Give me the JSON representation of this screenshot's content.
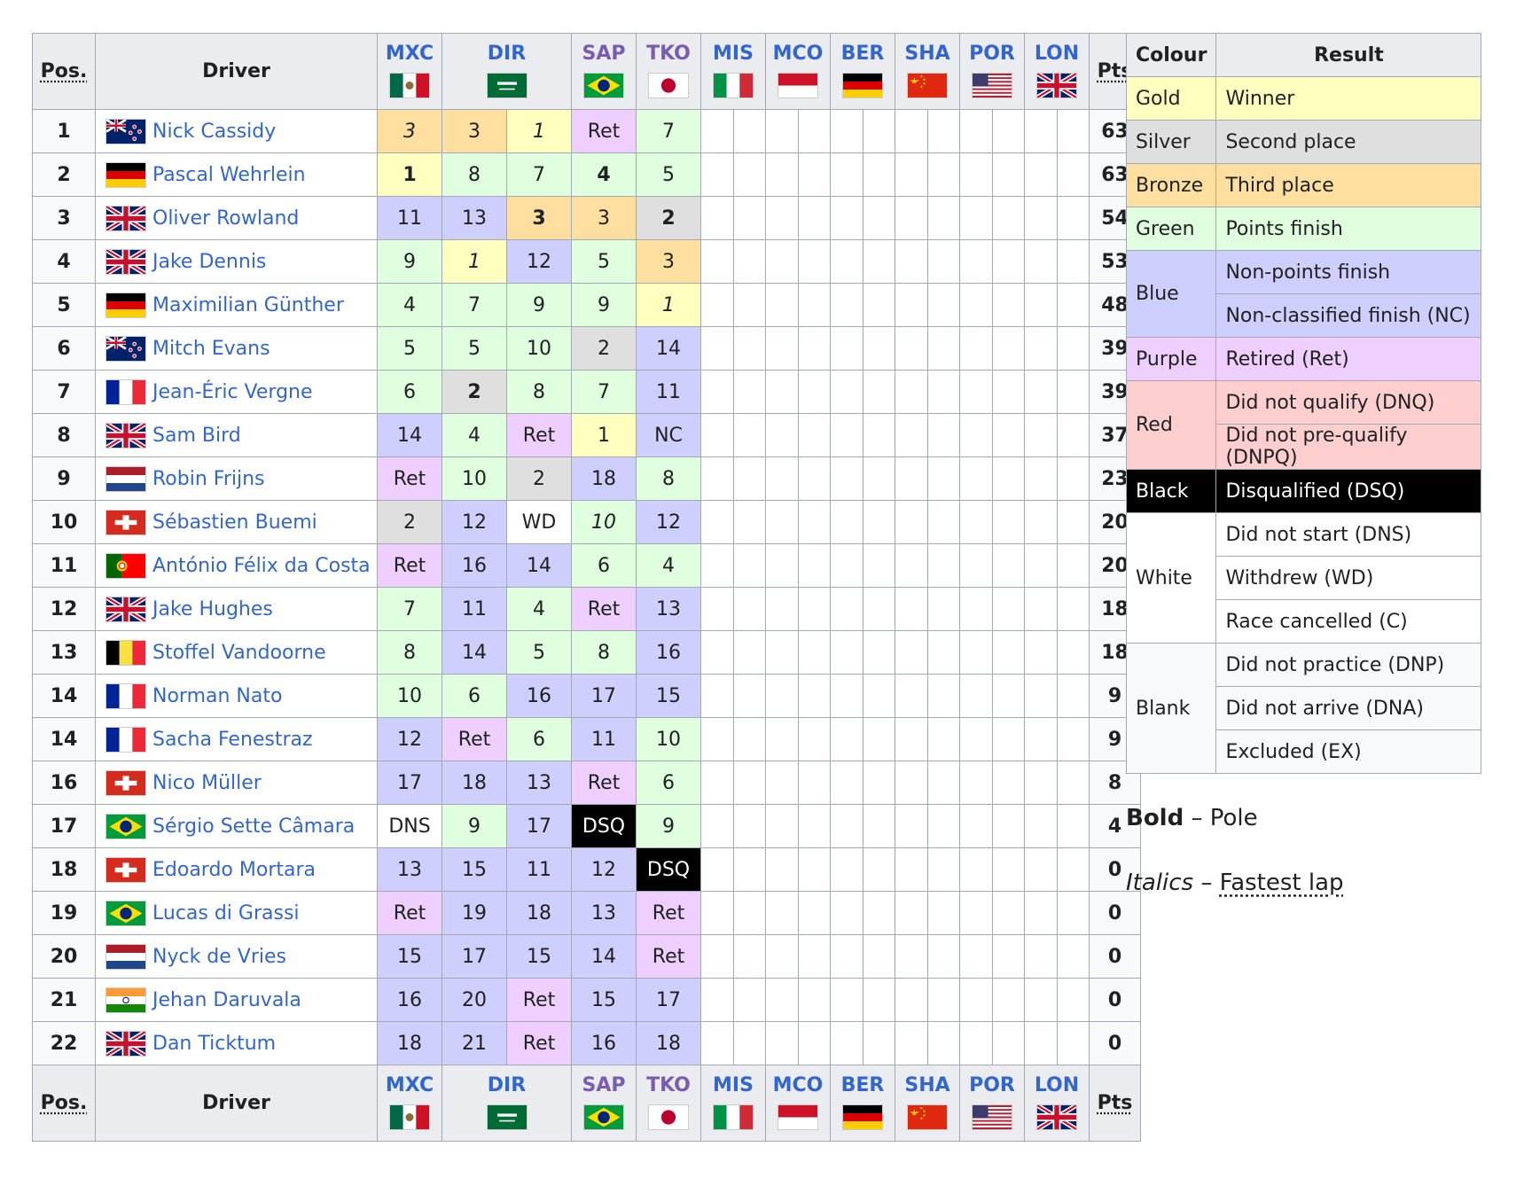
{
  "headers": {
    "pos": "Pos.",
    "driver": "Driver",
    "pts": "Pts"
  },
  "races": [
    {
      "code": "MXC",
      "flag": "mx",
      "visited": false
    },
    {
      "code": "DIR",
      "flag": "sa",
      "visited": false
    },
    {
      "code": "SAP",
      "flag": "br",
      "visited": true
    },
    {
      "code": "TKO",
      "flag": "jp",
      "visited": true
    },
    {
      "code": "MIS",
      "flag": "it",
      "visited": false
    },
    {
      "code": "MCO",
      "flag": "mc",
      "visited": false
    },
    {
      "code": "BER",
      "flag": "de",
      "visited": false
    },
    {
      "code": "SHA",
      "flag": "cn",
      "visited": false
    },
    {
      "code": "POR",
      "flag": "us",
      "visited": false
    },
    {
      "code": "LON",
      "flag": "gb",
      "visited": false
    }
  ],
  "colors": {
    "gold": "#ffffbf",
    "silver": "#dfdfdf",
    "bronze": "#ffdf9f",
    "green": "#dfffdf",
    "blue": "#cfcfff",
    "purple": "#efcfff",
    "red": "#ffcfcf",
    "black": "#000000",
    "link": "#3366cc",
    "visited": "#795cb2"
  },
  "rows": [
    {
      "pos": "1",
      "flag": "nz",
      "driver": "Nick Cassidy",
      "pts": "63",
      "cells": [
        [
          "3",
          "bronze",
          "i"
        ],
        [
          "3",
          "bronze",
          ""
        ],
        [
          "1",
          "gold",
          "i"
        ],
        [
          "Ret",
          "purple",
          ""
        ],
        [
          "7",
          "green",
          ""
        ]
      ]
    },
    {
      "pos": "2",
      "flag": "de",
      "driver": "Pascal Wehrlein",
      "pts": "63",
      "cells": [
        [
          "1",
          "gold",
          "b"
        ],
        [
          "8",
          "green",
          ""
        ],
        [
          "7",
          "green",
          ""
        ],
        [
          "4",
          "green",
          "b"
        ],
        [
          "5",
          "green",
          ""
        ]
      ]
    },
    {
      "pos": "3",
      "flag": "gb",
      "driver": "Oliver Rowland",
      "pts": "54",
      "cells": [
        [
          "11",
          "blue",
          ""
        ],
        [
          "13",
          "blue",
          ""
        ],
        [
          "3",
          "bronze",
          "b"
        ],
        [
          "3",
          "bronze",
          ""
        ],
        [
          "2",
          "silver",
          "b"
        ]
      ]
    },
    {
      "pos": "4",
      "flag": "gb",
      "driver": "Jake Dennis",
      "pts": "53",
      "cells": [
        [
          "9",
          "green",
          ""
        ],
        [
          "1",
          "gold",
          "i"
        ],
        [
          "12",
          "blue",
          ""
        ],
        [
          "5",
          "green",
          ""
        ],
        [
          "3",
          "bronze",
          ""
        ]
      ]
    },
    {
      "pos": "5",
      "flag": "de",
      "driver": "Maximilian Günther",
      "pts": "48",
      "cells": [
        [
          "4",
          "green",
          ""
        ],
        [
          "7",
          "green",
          ""
        ],
        [
          "9",
          "green",
          ""
        ],
        [
          "9",
          "green",
          ""
        ],
        [
          "1",
          "gold",
          "i"
        ]
      ]
    },
    {
      "pos": "6",
      "flag": "nz",
      "driver": "Mitch Evans",
      "pts": "39",
      "cells": [
        [
          "5",
          "green",
          ""
        ],
        [
          "5",
          "green",
          ""
        ],
        [
          "10",
          "green",
          ""
        ],
        [
          "2",
          "silver",
          ""
        ],
        [
          "14",
          "blue",
          ""
        ]
      ]
    },
    {
      "pos": "7",
      "flag": "fr",
      "driver": "Jean-Éric Vergne",
      "pts": "39",
      "cells": [
        [
          "6",
          "green",
          ""
        ],
        [
          "2",
          "silver",
          "b"
        ],
        [
          "8",
          "green",
          ""
        ],
        [
          "7",
          "green",
          ""
        ],
        [
          "11",
          "blue",
          ""
        ]
      ]
    },
    {
      "pos": "8",
      "flag": "gb",
      "driver": "Sam Bird",
      "pts": "37",
      "cells": [
        [
          "14",
          "blue",
          ""
        ],
        [
          "4",
          "green",
          ""
        ],
        [
          "Ret",
          "purple",
          ""
        ],
        [
          "1",
          "gold",
          ""
        ],
        [
          "NC",
          "blue",
          ""
        ]
      ]
    },
    {
      "pos": "9",
      "flag": "nl",
      "driver": "Robin Frijns",
      "pts": "23",
      "cells": [
        [
          "Ret",
          "purple",
          ""
        ],
        [
          "10",
          "green",
          ""
        ],
        [
          "2",
          "silver",
          ""
        ],
        [
          "18",
          "blue",
          ""
        ],
        [
          "8",
          "green",
          ""
        ]
      ]
    },
    {
      "pos": "10",
      "flag": "ch",
      "driver": "Sébastien Buemi",
      "pts": "20",
      "cells": [
        [
          "2",
          "silver",
          ""
        ],
        [
          "12",
          "blue",
          ""
        ],
        [
          "WD",
          "white",
          ""
        ],
        [
          "10",
          "green",
          "i"
        ],
        [
          "12",
          "blue",
          ""
        ]
      ]
    },
    {
      "pos": "11",
      "flag": "pt",
      "driver": "António Félix da Costa",
      "pts": "20",
      "cells": [
        [
          "Ret",
          "purple",
          ""
        ],
        [
          "16",
          "blue",
          ""
        ],
        [
          "14",
          "blue",
          ""
        ],
        [
          "6",
          "green",
          ""
        ],
        [
          "4",
          "green",
          ""
        ]
      ]
    },
    {
      "pos": "12",
      "flag": "gb",
      "driver": "Jake Hughes",
      "pts": "18",
      "cells": [
        [
          "7",
          "green",
          ""
        ],
        [
          "11",
          "blue",
          ""
        ],
        [
          "4",
          "green",
          ""
        ],
        [
          "Ret",
          "purple",
          ""
        ],
        [
          "13",
          "blue",
          ""
        ]
      ]
    },
    {
      "pos": "13",
      "flag": "be",
      "driver": "Stoffel Vandoorne",
      "pts": "18",
      "cells": [
        [
          "8",
          "green",
          ""
        ],
        [
          "14",
          "blue",
          ""
        ],
        [
          "5",
          "green",
          ""
        ],
        [
          "8",
          "green",
          ""
        ],
        [
          "16",
          "blue",
          ""
        ]
      ]
    },
    {
      "pos": "14",
      "flag": "fr",
      "driver": "Norman Nato",
      "pts": "9",
      "cells": [
        [
          "10",
          "green",
          ""
        ],
        [
          "6",
          "green",
          ""
        ],
        [
          "16",
          "blue",
          ""
        ],
        [
          "17",
          "blue",
          ""
        ],
        [
          "15",
          "blue",
          ""
        ]
      ]
    },
    {
      "pos": "14",
      "flag": "fr",
      "driver": "Sacha Fenestraz",
      "pts": "9",
      "cells": [
        [
          "12",
          "blue",
          ""
        ],
        [
          "Ret",
          "purple",
          ""
        ],
        [
          "6",
          "green",
          ""
        ],
        [
          "11",
          "blue",
          ""
        ],
        [
          "10",
          "green",
          ""
        ]
      ]
    },
    {
      "pos": "16",
      "flag": "ch",
      "driver": "Nico Müller",
      "pts": "8",
      "cells": [
        [
          "17",
          "blue",
          ""
        ],
        [
          "18",
          "blue",
          ""
        ],
        [
          "13",
          "blue",
          ""
        ],
        [
          "Ret",
          "purple",
          ""
        ],
        [
          "6",
          "green",
          ""
        ]
      ]
    },
    {
      "pos": "17",
      "flag": "br",
      "driver": "Sérgio Sette Câmara",
      "pts": "4",
      "cells": [
        [
          "DNS",
          "white",
          ""
        ],
        [
          "9",
          "green",
          ""
        ],
        [
          "17",
          "blue",
          ""
        ],
        [
          "DSQ",
          "black",
          ""
        ],
        [
          "9",
          "green",
          ""
        ]
      ]
    },
    {
      "pos": "18",
      "flag": "ch",
      "driver": "Edoardo Mortara",
      "pts": "0",
      "cells": [
        [
          "13",
          "blue",
          ""
        ],
        [
          "15",
          "blue",
          ""
        ],
        [
          "11",
          "blue",
          ""
        ],
        [
          "12",
          "blue",
          ""
        ],
        [
          "DSQ",
          "black",
          ""
        ]
      ]
    },
    {
      "pos": "19",
      "flag": "br",
      "driver": "Lucas di Grassi",
      "pts": "0",
      "cells": [
        [
          "Ret",
          "purple",
          ""
        ],
        [
          "19",
          "blue",
          ""
        ],
        [
          "18",
          "blue",
          ""
        ],
        [
          "13",
          "blue",
          ""
        ],
        [
          "Ret",
          "purple",
          ""
        ]
      ]
    },
    {
      "pos": "20",
      "flag": "nl",
      "driver": "Nyck de Vries",
      "pts": "0",
      "cells": [
        [
          "15",
          "blue",
          ""
        ],
        [
          "17",
          "blue",
          ""
        ],
        [
          "15",
          "blue",
          ""
        ],
        [
          "14",
          "blue",
          ""
        ],
        [
          "Ret",
          "purple",
          ""
        ]
      ]
    },
    {
      "pos": "21",
      "flag": "in",
      "driver": "Jehan Daruvala",
      "pts": "0",
      "cells": [
        [
          "16",
          "blue",
          ""
        ],
        [
          "20",
          "blue",
          ""
        ],
        [
          "Ret",
          "purple",
          ""
        ],
        [
          "15",
          "blue",
          ""
        ],
        [
          "17",
          "blue",
          ""
        ]
      ]
    },
    {
      "pos": "22",
      "flag": "gb",
      "driver": "Dan Ticktum",
      "pts": "0",
      "cells": [
        [
          "18",
          "blue",
          ""
        ],
        [
          "21",
          "blue",
          ""
        ],
        [
          "Ret",
          "purple",
          ""
        ],
        [
          "16",
          "blue",
          ""
        ],
        [
          "18",
          "blue",
          ""
        ]
      ]
    }
  ],
  "legend": {
    "headers": {
      "colour": "Colour",
      "result": "Result"
    },
    "groups": [
      {
        "colour": "Gold",
        "cls": "gold",
        "results": [
          "Winner"
        ]
      },
      {
        "colour": "Silver",
        "cls": "silver",
        "results": [
          "Second place"
        ]
      },
      {
        "colour": "Bronze",
        "cls": "bronze",
        "results": [
          "Third place"
        ]
      },
      {
        "colour": "Green",
        "cls": "green",
        "results": [
          "Points finish"
        ]
      },
      {
        "colour": "Blue",
        "cls": "blue",
        "results": [
          "Non-points finish",
          "Non-classified finish (NC)"
        ]
      },
      {
        "colour": "Purple",
        "cls": "purple",
        "results": [
          "Retired (Ret)"
        ]
      },
      {
        "colour": "Red",
        "cls": "red",
        "results": [
          "Did not qualify (DNQ)",
          "Did not pre-qualify (DNPQ)"
        ]
      },
      {
        "colour": "Black",
        "cls": "black",
        "results": [
          "Disqualified (DSQ)"
        ]
      },
      {
        "colour": "White",
        "cls": "white",
        "results": [
          "Did not start (DNS)",
          "Withdrew (WD)",
          "Race cancelled (C)"
        ]
      },
      {
        "colour": "Blank",
        "cls": "blank",
        "results": [
          "Did not practice (DNP)",
          "Did not arrive (DNA)",
          "Excluded (EX)"
        ]
      }
    ]
  },
  "notes": {
    "bold_word": "Bold",
    "bold_sep": " – ",
    "bold_desc": "Pole",
    "italic_word": "Italics",
    "italic_sep": " – ",
    "italic_desc": "Fastest lap"
  }
}
